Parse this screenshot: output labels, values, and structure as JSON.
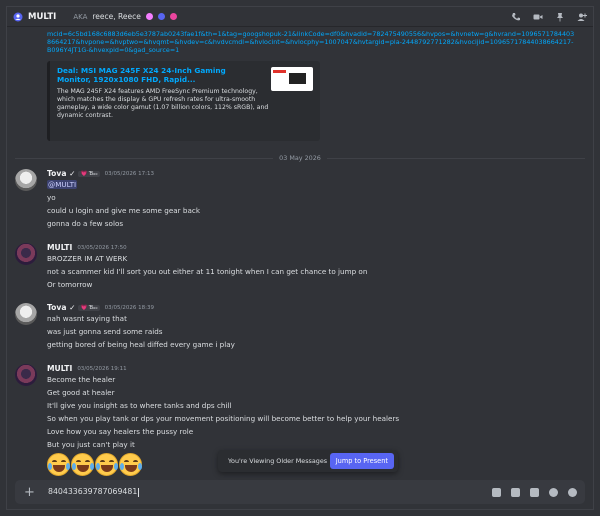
{
  "header": {
    "title": "MULTI",
    "aka_label": "AKA",
    "names": "reece, Reece"
  },
  "link": {
    "text": "mcid=6c5bd168c6883d6eb5e3787ab0243fae1f&th=1&tag=googshopuk-21&linkCode=df0&hvadid=782475490556&hvpos=&hvnetw=g&hvrand=10965717844038664217&hvpone=&hvptwo=&hvqmt=&hvdev=c&hvdvcmdl=&hvlocint=&hvlocphy=1007047&hvtargid=pla-2448792771282&hvocijid=10965717844038664217-B096Y4JT1G-&hvexpid=0&gad_source=1"
  },
  "embed": {
    "title": "Deal: MSI MAG 245F X24 24-Inch Gaming Monitor, 1920x1080 FHD, Rapid...",
    "description": "The MAG 245F X24 features AMD FreeSync Premium technology, which matches the display & GPU refresh rates for ultra-smooth gameplay, a wide color gamut (1.07 billion colors, 112% sRGB), and dynamic contrast."
  },
  "divider_date": "03 May 2026",
  "messages": [
    {
      "author": "Tova ✓",
      "tag": "💗 Ɓₒₒ",
      "time": "03/05/2026 17:13",
      "mention": "@MULTI",
      "lines": [
        "yo",
        "could u login and give me some gear back",
        "gonna do a few solos"
      ]
    },
    {
      "author": "MULTI",
      "time": "03/05/2026 17:50",
      "lines": [
        "BROZZER IM AT WERK",
        "not a scammer kid I'll sort you out either at 11 tonight when I can get chance to jump on",
        "Or tomorrow"
      ]
    },
    {
      "author": "Tova ✓",
      "tag": "💗 Ɓₒₒ",
      "time": "03/05/2026 18:39",
      "lines": [
        "nah wasnt saying that",
        "was just gonna send some raids",
        "getting bored of being heal diffed every game i play"
      ]
    },
    {
      "author": "MULTI",
      "time": "03/05/2026 19:11",
      "lines": [
        "Become the healer",
        "Get good at healer",
        "It'll give you insight as to where tanks and dps chill",
        "So when you play tank or dps your movement positioning will become better to help your healers",
        "Love how you say healers the pussy role",
        "But you just can't play it"
      ],
      "emoji_count": 4
    }
  ],
  "toast": {
    "text": "You're Viewing Older Messages",
    "button": "Jump to Present"
  },
  "composer": {
    "value": "840433639787069481"
  },
  "colors": {
    "accent": "#5865f2",
    "link": "#00a8fc",
    "background": "#313338"
  }
}
